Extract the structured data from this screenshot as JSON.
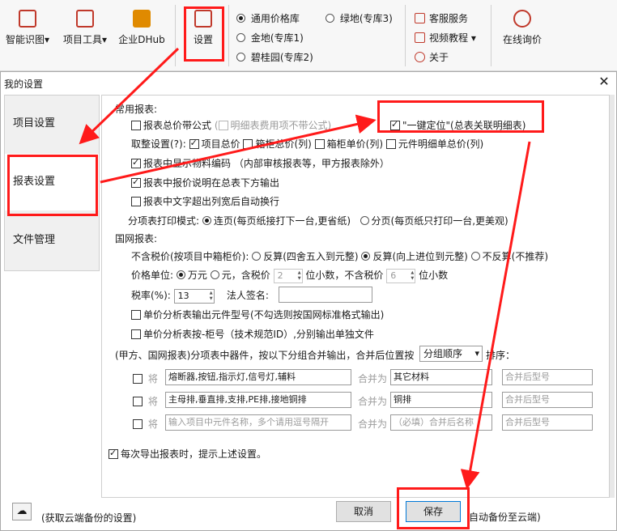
{
  "ribbon": {
    "smart_recognition": "智能识图",
    "project_tools": "项目工具",
    "enterprise_dhub": "企业DHub",
    "settings": "设置",
    "radios": [
      "通用价格库",
      "金地(专库1)",
      "碧桂园(专库2)",
      "绿地(专库3)"
    ],
    "customer_service": "客服服务",
    "video_tutorial": "视频教程",
    "about": "关于",
    "online_inquiry": "在线询价"
  },
  "dialog": {
    "title": "我的设置",
    "close": "✕",
    "nav": [
      "项目设置",
      "报表设置",
      "文件管理"
    ],
    "common_reports": "常用报表:",
    "formula_total": "报表总价带公式",
    "detail_no_formula": "明细表费用项不带公式)",
    "one_click_locate": "\"一键定位\"(总表关联明细表)",
    "rounding_setting": "取整设置(?):",
    "project_total": "项目总价",
    "cabinet_total": "箱柜总价(列)",
    "cabinet_unit": "箱柜单价(列)",
    "component_detail_total": "元件明细单总价(列)",
    "show_material_code": "报表中显示物料编码",
    "material_code_note": "（内部审核报表等，甲方报表除外）",
    "quote_note_below": "报表中报价说明在总表下方输出",
    "wrap_text": "报表中文字超出列宽后自动换行",
    "itemized_print_mode": "分项表打印模式:",
    "continuous_page": "连页(每页纸接打下一台,更省纸)",
    "separate_page": "分页(每页纸只打印一台,更美观)",
    "national_grid": "国网报表:",
    "tax_exclusive": "不含税价(按项目中箱柜价):",
    "reverse_round": "反算(四舍五入到元整)",
    "reverse_up": "反算(向上进位到元整)",
    "no_reverse": "不反算(不推荐)",
    "price_unit": "价格单位:",
    "wan_yuan": "万元",
    "yuan_tax_incl": "元，含税价",
    "tax_incl_decimals": "2",
    "decimals_label_1": "位小数，不含税价",
    "tax_excl_decimals": "6",
    "decimals_label_2": "位小数",
    "tax_rate_label": "税率(%):",
    "tax_rate": "13",
    "legal_signature": "法人签名:",
    "unit_price_model": "单价分析表输出元件型号(不勾选则按国网标准格式输出)",
    "unit_price_by_cabinet": "单价分析表按-柜号（技术规范ID）,分别输出单独文件",
    "merge_intro": "(甲方、国网报表)分项表中器件，按以下分组合并输出，合并后位置按",
    "group_order": "分组顺序",
    "sort_label": "排序：",
    "will": "将",
    "merge_as": "合并为",
    "merge_rows": [
      {
        "items": "熔断器,按钮,指示灯,信号灯,辅料",
        "target": "其它材料",
        "model_placeholder": "合并后型号"
      },
      {
        "items": "主母排,垂直排,支排,PE排,接地铜排",
        "target": "铜排",
        "model_placeholder": "合并后型号"
      },
      {
        "items_placeholder": "输入项目中元件名称，多个请用逗号隔开",
        "target_placeholder": "（必填）合并后名称",
        "model_placeholder": "合并后型号"
      }
    ],
    "remind_on_export": "每次导出报表时，提示上述设置。",
    "cloud_backup_get": "(获取云端备份的设置)",
    "cancel": "取消",
    "save": "保存",
    "auto_backup": "自动备份至云端)"
  },
  "colors": {
    "annotation_red": "#ff1a1a",
    "brand_red": "#c0392b"
  }
}
